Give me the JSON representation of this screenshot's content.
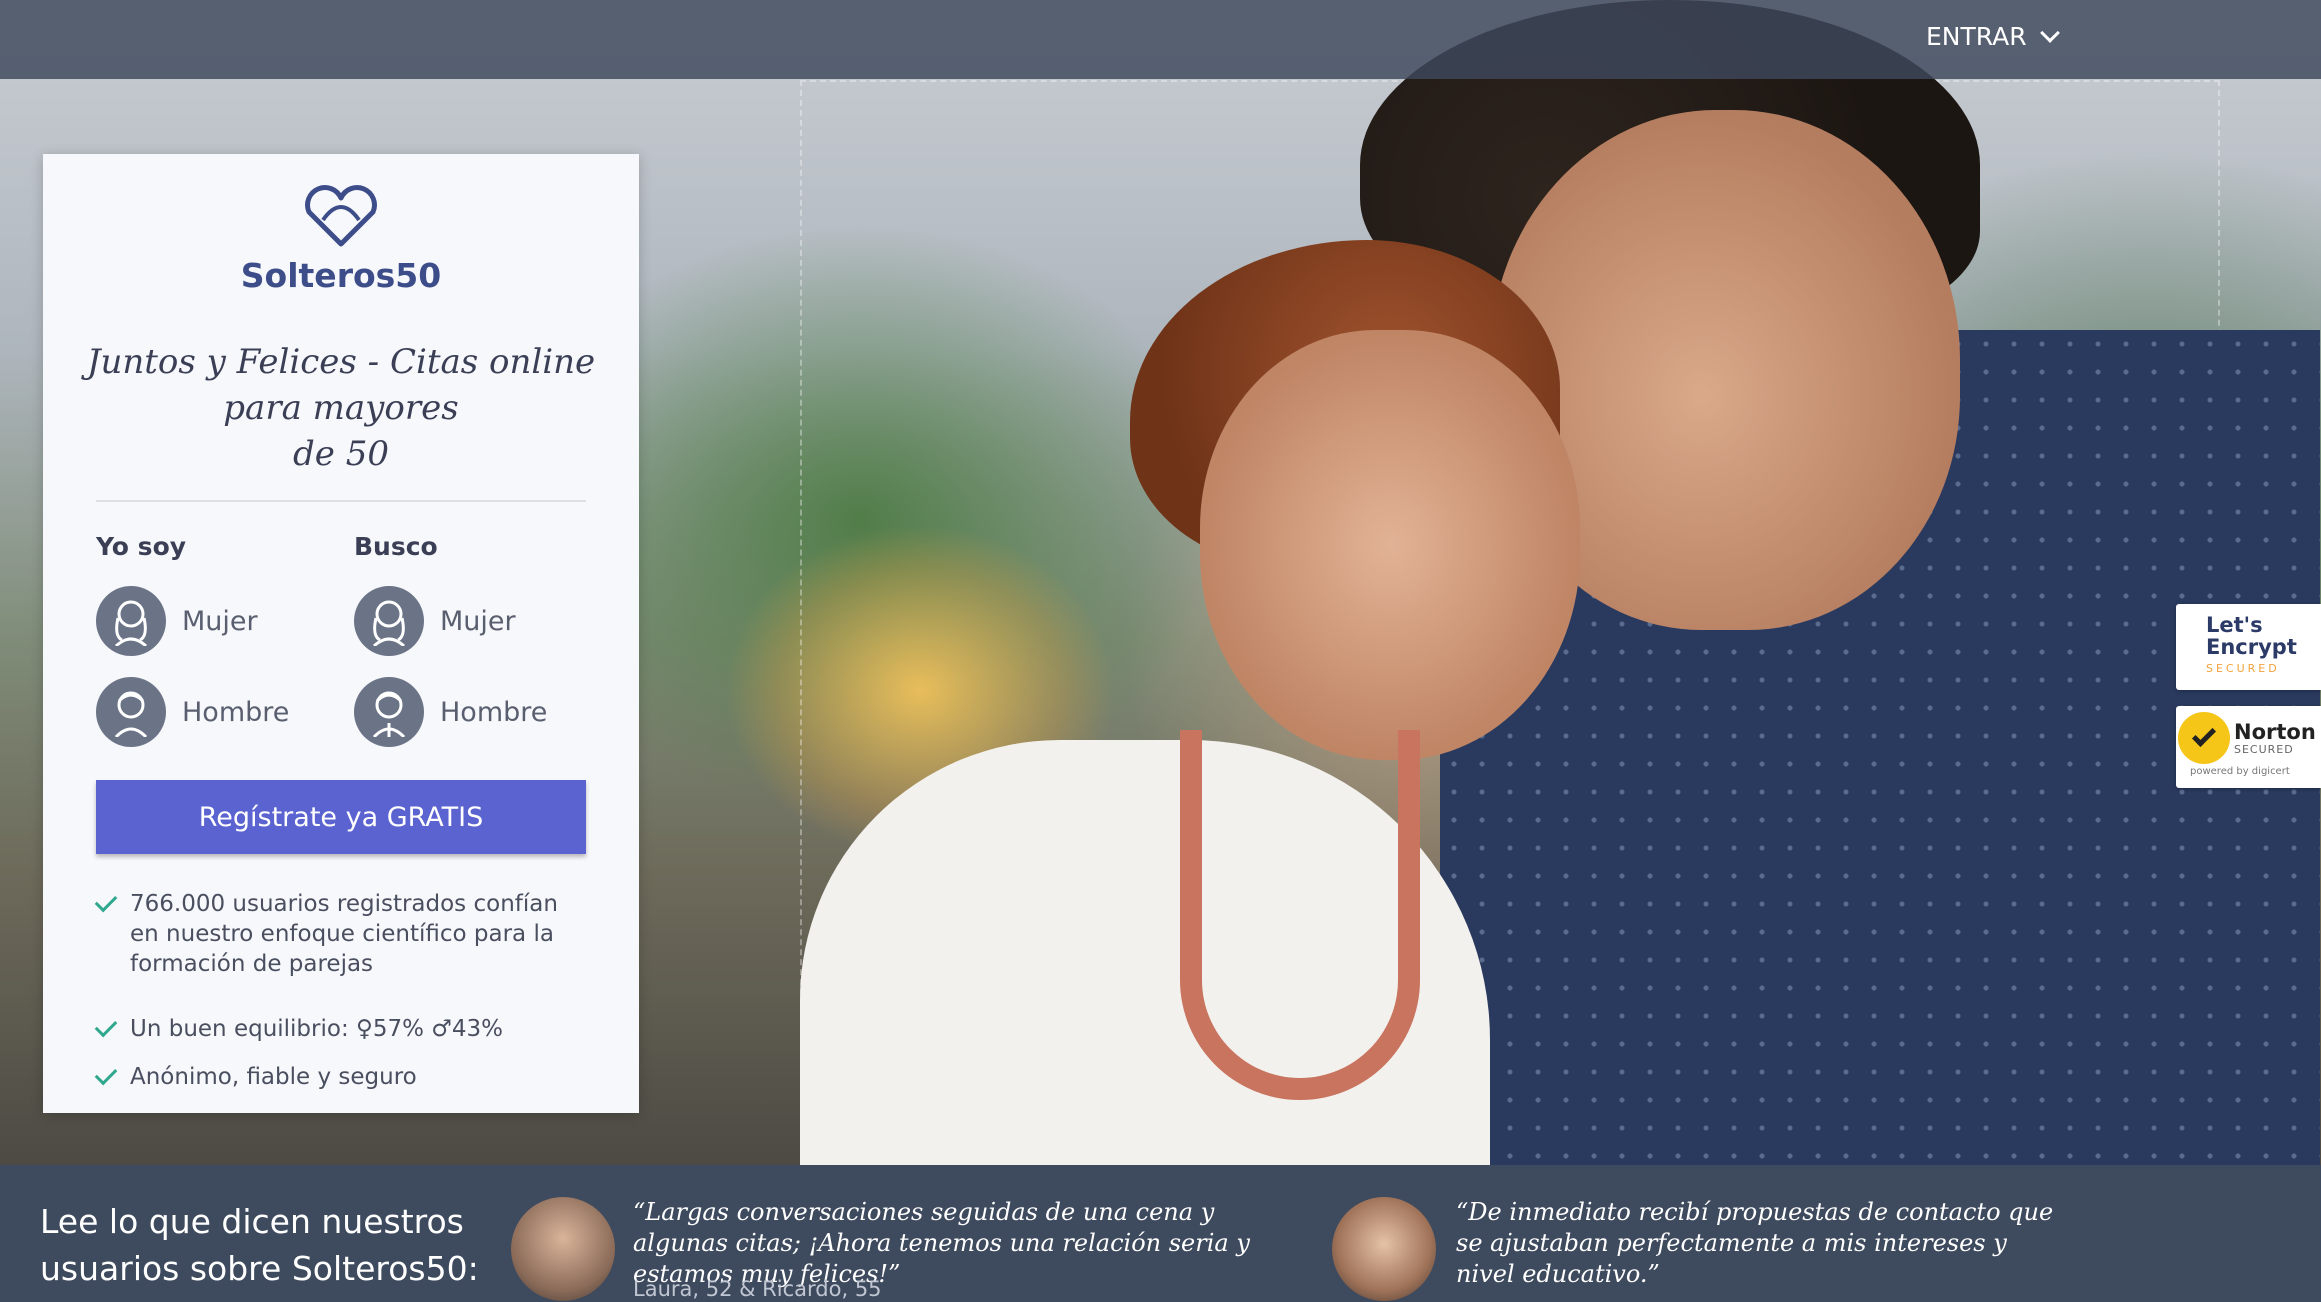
{
  "topbar": {
    "login_label": "ENTRAR"
  },
  "brand": {
    "name": "Solteros50"
  },
  "tagline": {
    "line1": "Juntos y Felices - Citas online",
    "line2": "para mayores",
    "line3": "de 50"
  },
  "form": {
    "i_am_label": "Yo soy",
    "seeking_label": "Busco",
    "options": {
      "woman": "Mujer",
      "man": "Hombre"
    },
    "cta_label": "Regístrate ya GRATIS"
  },
  "bullets": [
    "766.000 usuarios registrados confían en nuestro enfoque científico para la formación de parejas",
    "Un buen equilibrio: ♀57% ♂43%",
    "Anónimo, fiable y seguro"
  ],
  "badges": {
    "letsencrypt_title": "Let's Encrypt",
    "letsencrypt_sub": "SECURED",
    "norton_title": "Norton",
    "norton_sub": "SECURED",
    "norton_powered": "powered by digicert"
  },
  "testimonials": {
    "heading": "Lee lo que dicen nuestros usuarios  sobre Solteros50:",
    "items": [
      {
        "quote": "“Largas conversaciones seguidas de una cena y algunas citas; ¡Ahora tenemos una relación seria y estamos muy felices!”",
        "author": "Laura, 52 & Ricardo, 55"
      },
      {
        "quote": "“De inmediato recibí propuestas de contacto que se ajustaban perfectamente a mis intereses y nivel educativo.”"
      }
    ]
  },
  "colors": {
    "brand": "#3d4d8a",
    "cta": "#5a63cf",
    "check": "#2fa88e",
    "topbar": "#3e485c"
  }
}
